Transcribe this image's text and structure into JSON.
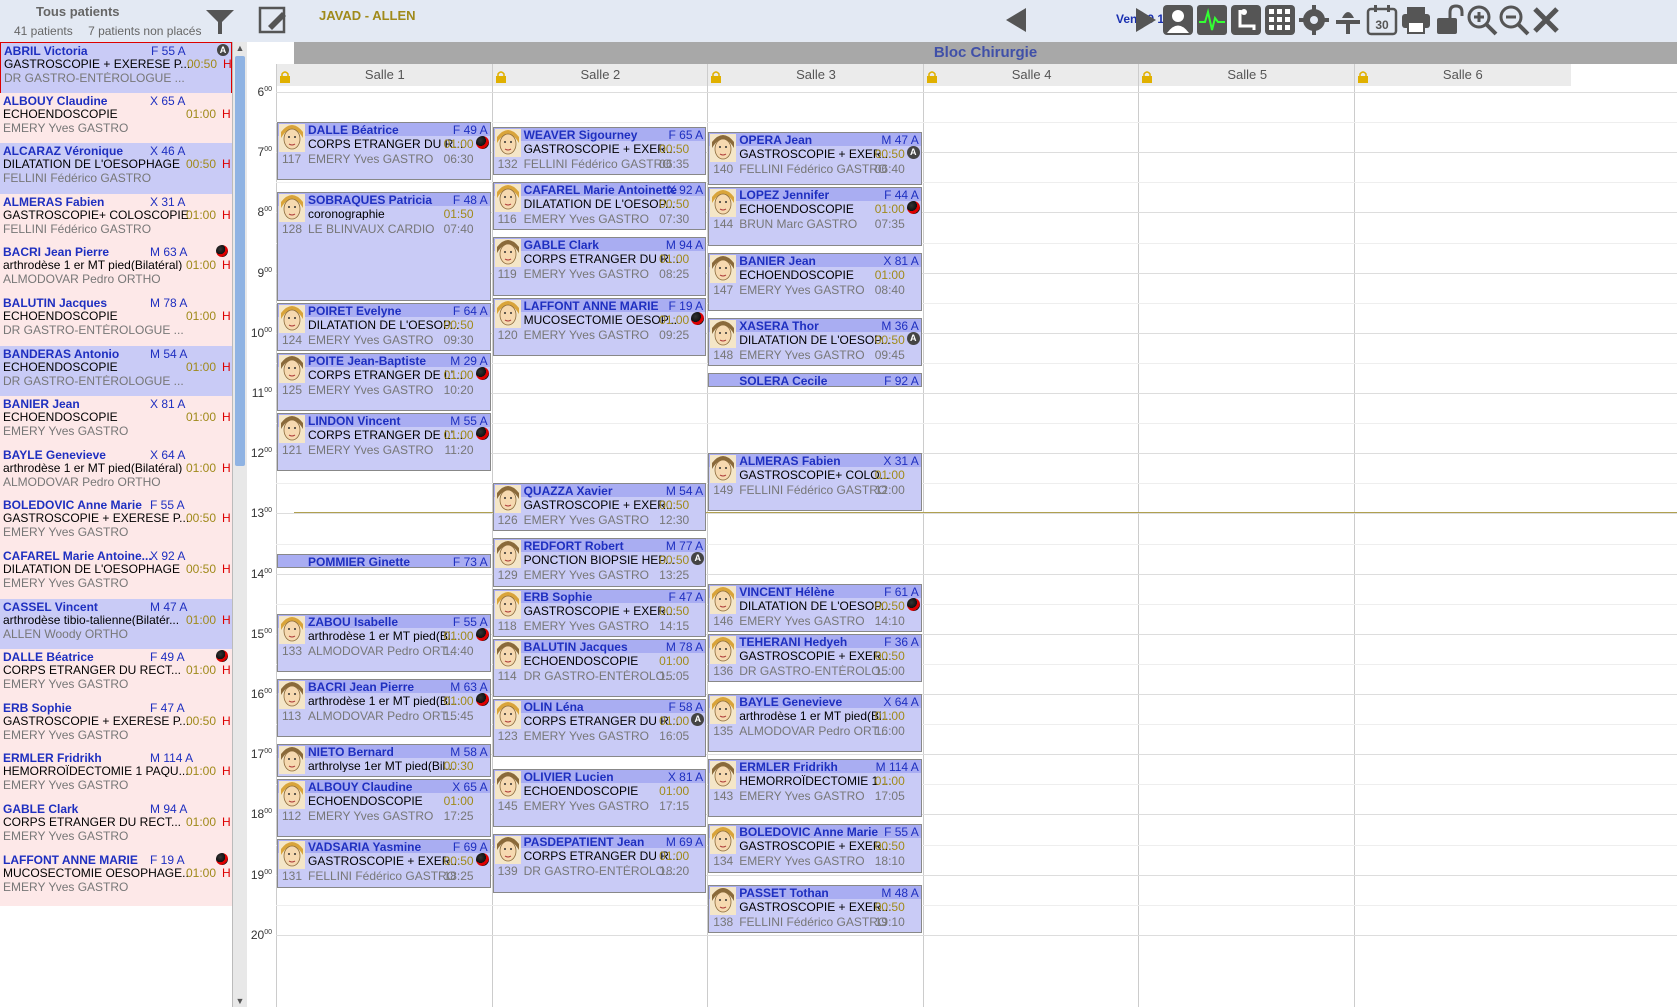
{
  "sidebar": {
    "title": "Tous patients",
    "count_patients": "41 patients",
    "count_unplaced": "7 patients non placés",
    "items": [
      {
        "name": "ABRIL Victoria",
        "sex": "F 55 A",
        "proc": "GASTROSCOPIE + EXERESE P...",
        "dur": "00:50",
        "h": "H",
        "doc": "DR GASTRO-ENTÉROLOGUE ...",
        "flag": "anes"
      },
      {
        "name": "ALBOUY Claudine",
        "sex": "X 65 A",
        "proc": "ECHOENDOSCOPIE",
        "dur": "01:00",
        "h": "H",
        "doc": "EMERY Yves GASTRO",
        "flag": ""
      },
      {
        "name": "ALCARAZ Véronique",
        "sex": "X 46 A",
        "proc": "DILATATION DE L'OESOPHAGE",
        "dur": "00:50",
        "h": "H",
        "doc": "FELLINI Fédérico GASTRO",
        "flag": ""
      },
      {
        "name": "ALMERAS Fabien",
        "sex": "X 31 A",
        "proc": "GASTROSCOPIE+ COLOSCOPIE",
        "dur": "01:00",
        "h": "H",
        "doc": "FELLINI Fédérico GASTRO",
        "flag": ""
      },
      {
        "name": "BACRI Jean Pierre",
        "sex": "M 63 A",
        "proc": "arthrodèse 1 er MT pied(Bilatéral)",
        "dur": "01:00",
        "h": "H",
        "doc": "ALMODOVAR Pedro ORTHO",
        "flag": "ball"
      },
      {
        "name": "BALUTIN Jacques",
        "sex": "M 78 A",
        "proc": "ECHOENDOSCOPIE",
        "dur": "01:00",
        "h": "H",
        "doc": "DR GASTRO-ENTÉROLOGUE ...",
        "flag": ""
      },
      {
        "name": "BANDERAS Antonio",
        "sex": "M 54 A",
        "proc": "ECHOENDOSCOPIE",
        "dur": "01:00",
        "h": "H",
        "doc": "DR GASTRO-ENTÉROLOGUE ...",
        "flag": ""
      },
      {
        "name": "BANIER Jean",
        "sex": "X 81 A",
        "proc": "ECHOENDOSCOPIE",
        "dur": "01:00",
        "h": "H",
        "doc": "EMERY Yves GASTRO",
        "flag": ""
      },
      {
        "name": "BAYLE Genevieve",
        "sex": "X 64 A",
        "proc": "arthrodèse 1 er MT pied(Bilatéral)",
        "dur": "01:00",
        "h": "H",
        "doc": "ALMODOVAR Pedro ORTHO",
        "flag": ""
      },
      {
        "name": "BOLEDOVIC Anne Marie",
        "sex": "F 55 A",
        "proc": "GASTROSCOPIE + EXERESE P...",
        "dur": "00:50",
        "h": "H",
        "doc": "EMERY Yves GASTRO",
        "flag": ""
      },
      {
        "name": "CAFAREL Marie Antoine...",
        "sex": "X 92 A",
        "proc": "DILATATION DE L'OESOPHAGE",
        "dur": "00:50",
        "h": "H",
        "doc": "EMERY Yves GASTRO",
        "flag": ""
      },
      {
        "name": "CASSEL Vincent",
        "sex": "M 47 A",
        "proc": "arthrodèse tibio-talienne(Bilatér...",
        "dur": "01:00",
        "h": "H",
        "doc": "ALLEN Woody ORTHO",
        "flag": ""
      },
      {
        "name": "DALLE Béatrice",
        "sex": "F 49 A",
        "proc": "CORPS ETRANGER DU RECT...",
        "dur": "01:00",
        "h": "H",
        "doc": "EMERY Yves GASTRO",
        "flag": "ball"
      },
      {
        "name": "ERB Sophie",
        "sex": "F 47 A",
        "proc": "GASTROSCOPIE + EXERESE P...",
        "dur": "00:50",
        "h": "H",
        "doc": "EMERY Yves GASTRO",
        "flag": ""
      },
      {
        "name": "ERMLER Fridrikh",
        "sex": "M 114 A",
        "proc": "HEMORROÏDECTOMIE 1 PAQU...",
        "dur": "01:00",
        "h": "H",
        "doc": "EMERY Yves GASTRO",
        "flag": ""
      },
      {
        "name": "GABLE Clark",
        "sex": "M 94 A",
        "proc": "CORPS ETRANGER DU RECT...",
        "dur": "01:00",
        "h": "H",
        "doc": "EMERY Yves GASTRO",
        "flag": ""
      },
      {
        "name": "LAFFONT ANNE MARIE",
        "sex": "F 19 A",
        "proc": "MUCOSECTOMIE OESOPHAGE...",
        "dur": "01:00",
        "h": "H",
        "doc": "EMERY Yves GASTRO",
        "flag": "ball"
      }
    ]
  },
  "toolbar": {
    "surgeon": "JAVAD - ALLEN",
    "date": "Ven 19 12 14",
    "calendar_day": "30"
  },
  "grid": {
    "bloc_title": "Bloc Chirurgie",
    "rooms": [
      "Salle 1",
      "Salle 2",
      "Salle 3",
      "Salle 4",
      "Salle 5",
      "Salle 6"
    ],
    "hours": [
      "6",
      "7",
      "8",
      "9",
      "10",
      "11",
      "12",
      "13",
      "14",
      "15",
      "16",
      "17",
      "18",
      "19",
      "20"
    ],
    "hour_suffix": "00"
  },
  "appointments": [
    {
      "room": 0,
      "start": "06:30",
      "end": "07:30",
      "name": "DALLE Béatrice",
      "sex": "F 49 A",
      "proc": "CORPS ETRANGER DU R...",
      "dur": "01:00",
      "doc": "EMERY Yves GASTRO",
      "time": "06:30",
      "num": "117",
      "flag": "ball",
      "avatar": "F"
    },
    {
      "room": 0,
      "start": "07:40",
      "end": "09:30",
      "name": "SOBRAQUES Patricia",
      "sex": "F 48 A",
      "proc": "coronographie",
      "dur": "01:50",
      "doc": "LE BLINVAUX CARDIO",
      "time": "07:40",
      "num": "128",
      "flag": "",
      "avatar": "F"
    },
    {
      "room": 0,
      "start": "09:30",
      "end": "10:20",
      "name": "POIRET Evelyne",
      "sex": "F 64 A",
      "proc": "DILATATION DE L'OESOP...",
      "dur": "00:50",
      "doc": "EMERY Yves GASTRO",
      "time": "09:30",
      "num": "124",
      "flag": "",
      "avatar": "F"
    },
    {
      "room": 0,
      "start": "10:20",
      "end": "11:20",
      "name": "POITE Jean-Baptiste",
      "sex": "M 29 A",
      "proc": "CORPS ETRANGER DE L'...",
      "dur": "01:00",
      "doc": "EMERY Yves GASTRO",
      "time": "10:20",
      "num": "125",
      "flag": "ball",
      "avatar": "M"
    },
    {
      "room": 0,
      "start": "11:20",
      "end": "12:20",
      "name": "LINDON Vincent",
      "sex": "M 55 A",
      "proc": "CORPS ETRANGER DE L'...",
      "dur": "01:00",
      "doc": "EMERY Yves GASTRO",
      "time": "11:20",
      "num": "121",
      "flag": "ball",
      "avatar": "M"
    },
    {
      "room": 0,
      "start": "13:40",
      "end": "13:55",
      "name": "POMMIER Ginette",
      "sex": "F 73 A",
      "proc": "",
      "dur": "",
      "doc": "",
      "time": "",
      "num": "",
      "flag": "",
      "avatar": "F"
    },
    {
      "room": 0,
      "start": "14:40",
      "end": "15:40",
      "name": "ZABOU Isabelle",
      "sex": "F 55 A",
      "proc": "arthrodèse 1 er MT pied(Bi...",
      "dur": "01:00",
      "doc": "ALMODOVAR Pedro ORT...",
      "time": "14:40",
      "num": "133",
      "flag": "ball",
      "avatar": "F"
    },
    {
      "room": 0,
      "start": "15:45",
      "end": "16:45",
      "name": "BACRI Jean Pierre",
      "sex": "M 63 A",
      "proc": "arthrodèse 1 er MT pied(Bi...",
      "dur": "01:00",
      "doc": "ALMODOVAR Pedro ORT...",
      "time": "15:45",
      "num": "113",
      "flag": "ball",
      "avatar": "M"
    },
    {
      "room": 0,
      "start": "16:50",
      "end": "17:25",
      "name": "NIETO Bernard",
      "sex": "M 58 A",
      "proc": "arthrolyse 1er MT pied(Bil...",
      "dur": "00:30",
      "doc": "",
      "time": "",
      "num": "",
      "flag": "",
      "avatar": "M"
    },
    {
      "room": 0,
      "start": "17:25",
      "end": "18:25",
      "name": "ALBOUY Claudine",
      "sex": "X 65 A",
      "proc": "ECHOENDOSCOPIE",
      "dur": "01:00",
      "doc": "EMERY Yves GASTRO",
      "time": "17:25",
      "num": "112",
      "flag": "",
      "avatar": "F"
    },
    {
      "room": 0,
      "start": "18:25",
      "end": "19:15",
      "name": "VADSARIA Yasmine",
      "sex": "F 69 A",
      "proc": "GASTROSCOPIE + EXER...",
      "dur": "00:50",
      "doc": "FELLINI Fédérico GASTRO",
      "time": "18:25",
      "num": "131",
      "flag": "ball",
      "avatar": "F"
    },
    {
      "room": 1,
      "start": "06:35",
      "end": "07:25",
      "name": "WEAVER Sigourney",
      "sex": "F 65 A",
      "proc": "GASTROSCOPIE + EXER...",
      "dur": "00:50",
      "doc": "FELLINI Fédérico GASTRO",
      "time": "06:35",
      "num": "132",
      "flag": "",
      "avatar": "F"
    },
    {
      "room": 1,
      "start": "07:30",
      "end": "08:20",
      "name": "CAFAREL Marie Antoinette",
      "sex": "X 92 A",
      "proc": "DILATATION DE L'OESOP...",
      "dur": "00:50",
      "doc": "EMERY Yves GASTRO",
      "time": "07:30",
      "num": "116",
      "flag": "",
      "avatar": "F"
    },
    {
      "room": 1,
      "start": "08:25",
      "end": "09:25",
      "name": "GABLE Clark",
      "sex": "M 94 A",
      "proc": "CORPS ETRANGER DU R...",
      "dur": "01:00",
      "doc": "EMERY Yves GASTRO",
      "time": "08:25",
      "num": "119",
      "flag": "",
      "avatar": "M"
    },
    {
      "room": 1,
      "start": "09:25",
      "end": "10:25",
      "name": "LAFFONT ANNE MARIE",
      "sex": "F 19 A",
      "proc": "MUCOSECTOMIE OESOP...",
      "dur": "01:00",
      "doc": "EMERY Yves GASTRO",
      "time": "09:25",
      "num": "120",
      "flag": "ball",
      "avatar": "F"
    },
    {
      "room": 1,
      "start": "12:30",
      "end": "13:20",
      "name": "QUAZZA Xavier",
      "sex": "M 54 A",
      "proc": "GASTROSCOPIE + EXER...",
      "dur": "00:50",
      "doc": "EMERY Yves GASTRO",
      "time": "12:30",
      "num": "126",
      "flag": "",
      "avatar": "M"
    },
    {
      "room": 1,
      "start": "13:25",
      "end": "14:15",
      "name": "REDFORT Robert",
      "sex": "M 77 A",
      "proc": "PONCTION BIOPSIE HEP...",
      "dur": "00:50",
      "doc": "EMERY Yves GASTRO",
      "time": "13:25",
      "num": "129",
      "flag": "anes",
      "avatar": "M"
    },
    {
      "room": 1,
      "start": "14:15",
      "end": "15:05",
      "name": "ERB Sophie",
      "sex": "F 47 A",
      "proc": "GASTROSCOPIE + EXER...",
      "dur": "00:50",
      "doc": "EMERY Yves GASTRO",
      "time": "14:15",
      "num": "118",
      "flag": "",
      "avatar": "F"
    },
    {
      "room": 1,
      "start": "15:05",
      "end": "16:05",
      "name": "BALUTIN Jacques",
      "sex": "M 78 A",
      "proc": "ECHOENDOSCOPIE",
      "dur": "01:00",
      "doc": "DR GASTRO-ENTÉROLO...",
      "time": "15:05",
      "num": "114",
      "flag": "",
      "avatar": "M"
    },
    {
      "room": 1,
      "start": "16:05",
      "end": "17:05",
      "name": "OLIN Léna",
      "sex": "F 58 A",
      "proc": "CORPS ETRANGER DU R...",
      "dur": "01:00",
      "doc": "EMERY Yves GASTRO",
      "time": "16:05",
      "num": "123",
      "flag": "anes",
      "avatar": "F"
    },
    {
      "room": 1,
      "start": "17:15",
      "end": "18:15",
      "name": "OLIVIER Lucien",
      "sex": "X 81 A",
      "proc": "ECHOENDOSCOPIE",
      "dur": "01:00",
      "doc": "EMERY Yves GASTRO",
      "time": "17:15",
      "num": "145",
      "flag": "",
      "avatar": "M"
    },
    {
      "room": 1,
      "start": "18:20",
      "end": "19:20",
      "name": "PASDEPATIENT Jean",
      "sex": "M 69 A",
      "proc": "CORPS ETRANGER DU R...",
      "dur": "01:00",
      "doc": "DR GASTRO-ENTÉROLO...",
      "time": "18:20",
      "num": "139",
      "flag": "",
      "avatar": "M"
    },
    {
      "room": 2,
      "start": "06:40",
      "end": "07:35",
      "name": "OPERA Jean",
      "sex": "M 47 A",
      "proc": "GASTROSCOPIE + EXER...",
      "dur": "00:50",
      "doc": "FELLINI Fédérico GASTRO",
      "time": "06:40",
      "num": "140",
      "flag": "anes",
      "avatar": "M"
    },
    {
      "room": 2,
      "start": "07:35",
      "end": "08:35",
      "name": "LOPEZ Jennifer",
      "sex": "F 44 A",
      "proc": "ECHOENDOSCOPIE",
      "dur": "01:00",
      "doc": "BRUN Marc GASTRO",
      "time": "07:35",
      "num": "144",
      "flag": "ball",
      "avatar": "F"
    },
    {
      "room": 2,
      "start": "08:40",
      "end": "09:40",
      "name": "BANIER Jean",
      "sex": "X 81 A",
      "proc": "ECHOENDOSCOPIE",
      "dur": "01:00",
      "doc": "EMERY Yves GASTRO",
      "time": "08:40",
      "num": "147",
      "flag": "",
      "avatar": "M"
    },
    {
      "room": 2,
      "start": "09:45",
      "end": "10:35",
      "name": "XASERA Thor",
      "sex": "M 36 A",
      "proc": "DILATATION DE L'OESOP...",
      "dur": "00:50",
      "doc": "EMERY Yves GASTRO",
      "time": "09:45",
      "num": "148",
      "flag": "anes",
      "avatar": "M"
    },
    {
      "room": 2,
      "start": "10:40",
      "end": "10:55",
      "name": "SOLERA Cecile",
      "sex": "F 92 A",
      "proc": "",
      "dur": "",
      "doc": "",
      "time": "",
      "num": "",
      "flag": "",
      "avatar": "F"
    },
    {
      "room": 2,
      "start": "12:00",
      "end": "13:00",
      "name": "ALMERAS Fabien",
      "sex": "X 31 A",
      "proc": "GASTROSCOPIE+ COLO...",
      "dur": "01:00",
      "doc": "FELLINI Fédérico GASTRO",
      "time": "12:00",
      "num": "149",
      "flag": "",
      "avatar": "M"
    },
    {
      "room": 2,
      "start": "14:10",
      "end": "15:00",
      "name": "VINCENT Hélène",
      "sex": "F 61 A",
      "proc": "DILATATION DE L'OESOP...",
      "dur": "00:50",
      "doc": "EMERY Yves GASTRO",
      "time": "14:10",
      "num": "146",
      "flag": "ball",
      "avatar": "F"
    },
    {
      "room": 2,
      "start": "15:00",
      "end": "15:50",
      "name": "TEHERANI Hedyeh",
      "sex": "F 36 A",
      "proc": "GASTROSCOPIE + EXER...",
      "dur": "00:50",
      "doc": "DR GASTRO-ENTÉROLO...",
      "time": "15:00",
      "num": "136",
      "flag": "",
      "avatar": "F"
    },
    {
      "room": 2,
      "start": "16:00",
      "end": "17:00",
      "name": "BAYLE Genevieve",
      "sex": "X 64 A",
      "proc": "arthrodèse 1 er MT pied(Bi...",
      "dur": "01:00",
      "doc": "ALMODOVAR Pedro ORT...",
      "time": "16:00",
      "num": "135",
      "flag": "",
      "avatar": "F"
    },
    {
      "room": 2,
      "start": "17:05",
      "end": "18:05",
      "name": "ERMLER Fridrikh",
      "sex": "M 114 A",
      "proc": "HEMORROÏDECTOMIE 1 ...",
      "dur": "01:00",
      "doc": "EMERY Yves GASTRO",
      "time": "17:05",
      "num": "143",
      "flag": "",
      "avatar": "M"
    },
    {
      "room": 2,
      "start": "18:10",
      "end": "19:00",
      "name": "BOLEDOVIC Anne Marie",
      "sex": "F 55 A",
      "proc": "GASTROSCOPIE + EXER...",
      "dur": "00:50",
      "doc": "EMERY Yves GASTRO",
      "time": "18:10",
      "num": "134",
      "flag": "",
      "avatar": "F"
    },
    {
      "room": 2,
      "start": "19:10",
      "end": "20:00",
      "name": "PASSET Tothan",
      "sex": "M 48 A",
      "proc": "GASTROSCOPIE + EXER...",
      "dur": "00:50",
      "doc": "FELLINI Fédérico GASTRO",
      "time": "19:10",
      "num": "138",
      "flag": "",
      "avatar": "M"
    }
  ],
  "colors": {
    "appt_bg": "#c9cbf6",
    "appt_head": "#a9adf2",
    "name_blue": "#1e2fc0",
    "duration_gold": "#a08a1a",
    "hospital_red": "#d00"
  }
}
